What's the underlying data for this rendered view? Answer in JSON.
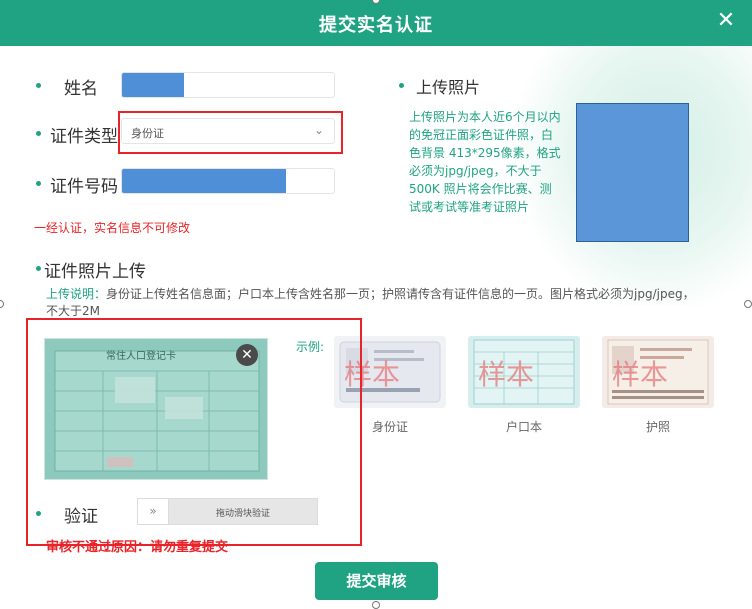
{
  "header": {
    "title": "提交实名认证",
    "close_glyph": "✕"
  },
  "form": {
    "name_label": "姓名",
    "id_type_label": "证件类型",
    "id_type_value": "身份证",
    "id_type_chevron": "⌄",
    "id_number_label": "证件号码",
    "warning": "一经认证，实名信息不可修改",
    "id_photo_title": "证件照片上传",
    "upload_hint_prefix": "上传说明：",
    "upload_hint": "身份证上传姓名信息面；户口本上传含姓名那一页；护照请传含有证件信息的一页。图片格式必须为jpg/jpeg，不大于2M",
    "example_label": "示例:",
    "samples": [
      {
        "caption": "身份证",
        "stamp": "样本"
      },
      {
        "caption": "户口本",
        "stamp": "样本"
      },
      {
        "caption": "护照",
        "stamp": "样本"
      }
    ],
    "uploaded_doc_title": "常住人口登记卡",
    "delete_glyph": "✕",
    "verify_label": "验证",
    "slider_handle": "»",
    "slider_text": "拖动滑块验证",
    "rejection_text": "审核不通过原因：请勿重复提交",
    "submit_label": "提交审核"
  },
  "photo_panel": {
    "title": "上传照片",
    "description": "上传照片为本人近6个月以内的免冠正面彩色证件照，白色背景 413*295像素，格式必须为jpg/jpeg，不大于500K 照片将会作比赛、测试或考试等准考证照片"
  },
  "colors": {
    "accent": "#1fa383",
    "error": "#e8242a",
    "redacted": "#4f8fd8"
  }
}
